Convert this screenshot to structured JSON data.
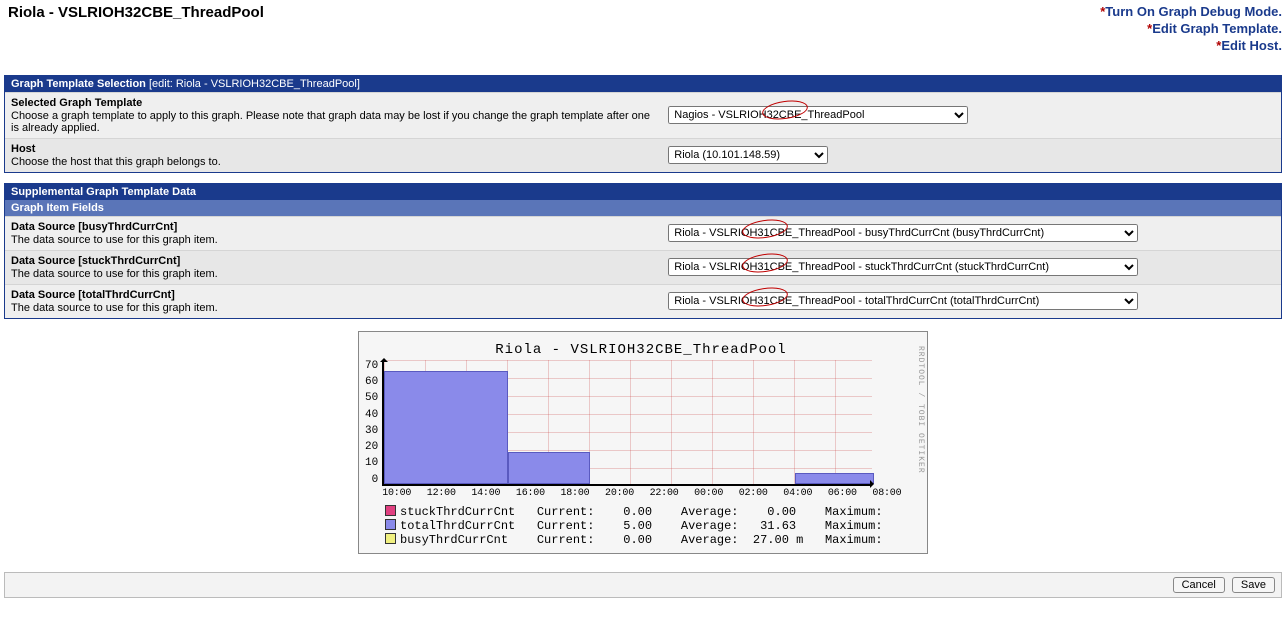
{
  "page_title": "Riola - VSLRIOH32CBE_ThreadPool",
  "top_links": {
    "debug": "Turn On Graph Debug Mode.",
    "template": "Edit Graph Template.",
    "host": "Edit Host."
  },
  "sections": {
    "gts": {
      "title": "Graph Template Selection",
      "edit": "[edit: Riola - VSLRIOH32CBE_ThreadPool]",
      "row_template_label": "Selected Graph Template",
      "row_template_desc": "Choose a graph template to apply to this graph. Please note that graph data may be lost if you change the graph template after one is already applied.",
      "row_template_value": "Nagios - VSLRIOH32CBE_ThreadPool",
      "row_host_label": "Host",
      "row_host_desc": "Choose the host that this graph belongs to.",
      "row_host_value": "Riola (10.101.148.59)"
    },
    "sup": {
      "title": "Supplemental Graph Template Data",
      "sub": "Graph Item Fields",
      "rows": [
        {
          "label": "Data Source [busyThrdCurrCnt]",
          "desc": "The data source to use for this graph item.",
          "value": "Riola - VSLRIOH31CBE_ThreadPool - busyThrdCurrCnt (busyThrdCurrCnt)"
        },
        {
          "label": "Data Source [stuckThrdCurrCnt]",
          "desc": "The data source to use for this graph item.",
          "value": "Riola - VSLRIOH31CBE_ThreadPool - stuckThrdCurrCnt (stuckThrdCurrCnt)"
        },
        {
          "label": "Data Source [totalThrdCurrCnt]",
          "desc": "The data source to use for this graph item.",
          "value": "Riola - VSLRIOH31CBE_ThreadPool - totalThrdCurrCnt (totalThrdCurrCnt)"
        }
      ]
    }
  },
  "chart_data": {
    "type": "bar",
    "title": "Riola - VSLRIOH32CBE_ThreadPool",
    "y_ticks": [
      "70",
      "60",
      "50",
      "40",
      "30",
      "20",
      "10",
      "0"
    ],
    "x_ticks": [
      "10:00",
      "12:00",
      "14:00",
      "16:00",
      "18:00",
      "20:00",
      "22:00",
      "00:00",
      "02:00",
      "04:00",
      "06:00",
      "08:00"
    ],
    "ylim": [
      0,
      70
    ],
    "categories": [
      "10:00-16:00",
      "16:00-20:00",
      "06:00-09:00"
    ],
    "values_approx": [
      63,
      18,
      6
    ],
    "watermark": "RRDTOOL / TOBI OETIKER",
    "legend": [
      {
        "color": "#e04080",
        "name": "stuckThrdCurrCnt",
        "current": "0.00",
        "average": "0.00",
        "maximum": ""
      },
      {
        "color": "#8a8aea",
        "name": "totalThrdCurrCnt",
        "current": "5.00",
        "average": "31.63",
        "maximum": ""
      },
      {
        "color": "#f0f080",
        "name": "busyThrdCurrCnt",
        "current": "0.00",
        "average": "27.00 m",
        "maximum": ""
      }
    ],
    "legend_headers": {
      "cur": "Current:",
      "avg": "Average:",
      "max": "Maximum:"
    }
  },
  "footer": {
    "cancel": "Cancel",
    "save": "Save"
  }
}
